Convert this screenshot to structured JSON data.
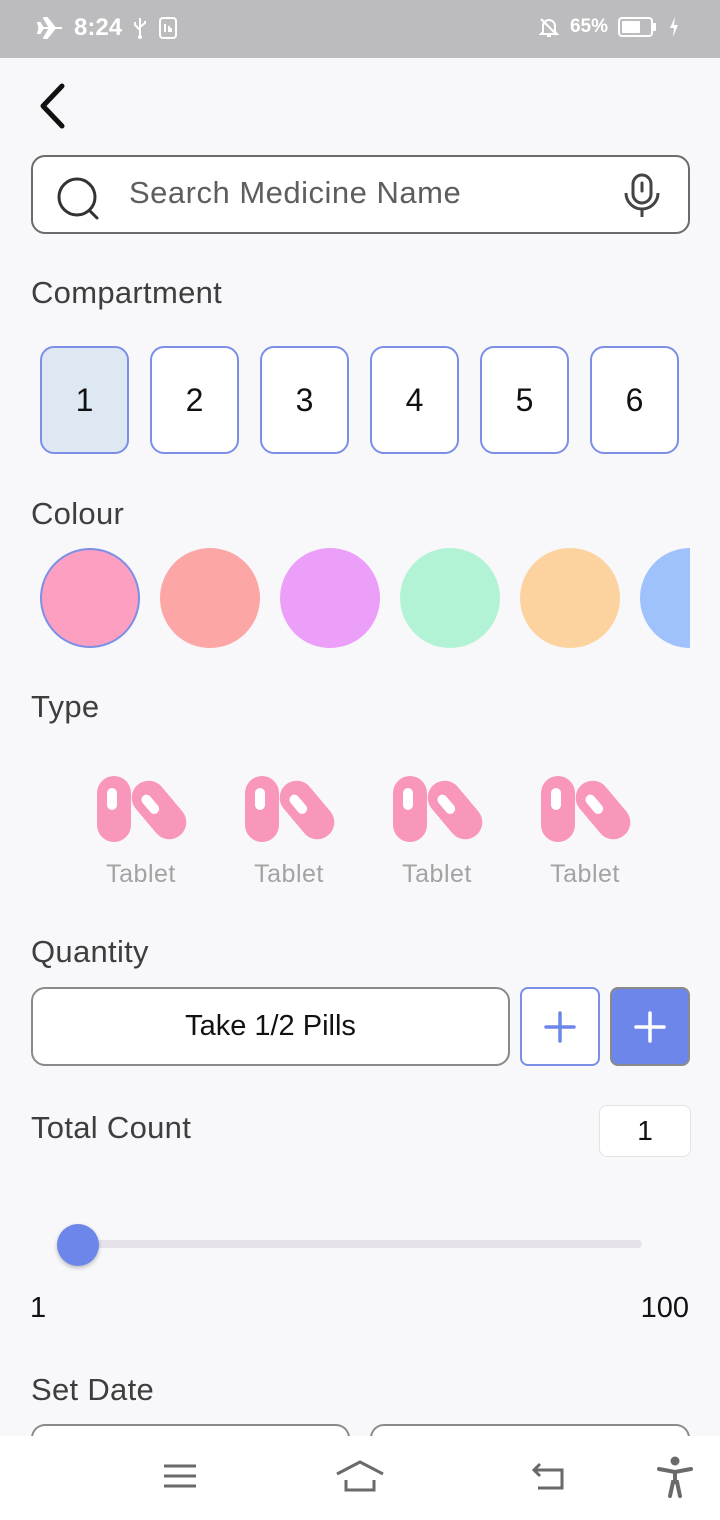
{
  "status_bar": {
    "time": "8:24",
    "battery_percent": "65%",
    "battery_level": 0.65
  },
  "search": {
    "placeholder": "Search Medicine Name"
  },
  "compartment": {
    "label": "Compartment",
    "options": [
      "1",
      "2",
      "3",
      "4",
      "5",
      "6"
    ],
    "selected": "1"
  },
  "colour": {
    "label": "Colour",
    "swatches": [
      "#fd9fc1",
      "#fca6a6",
      "#eb9ff8",
      "#b2f3d5",
      "#fcd39f",
      "#9fc1fc"
    ],
    "selected_index": 0
  },
  "type": {
    "label": "Type",
    "items": [
      {
        "label": "Tablet",
        "icon": "capsule-icon"
      },
      {
        "label": "Tablet",
        "icon": "capsule-icon"
      },
      {
        "label": "Tablet",
        "icon": "capsule-icon"
      },
      {
        "label": "Tablet",
        "icon": "capsule-icon"
      }
    ],
    "icon_color": "#f896bb"
  },
  "quantity": {
    "label": "Quantity",
    "value": "Take 1/2 Pills"
  },
  "total_count": {
    "label": "Total Count",
    "value": "1",
    "min": "1",
    "max": "100",
    "slider_value": 1
  },
  "set_date": {
    "label": "Set Date"
  },
  "colors": {
    "accent": "#6d86ea",
    "border_accent": "#7b8fe6"
  }
}
